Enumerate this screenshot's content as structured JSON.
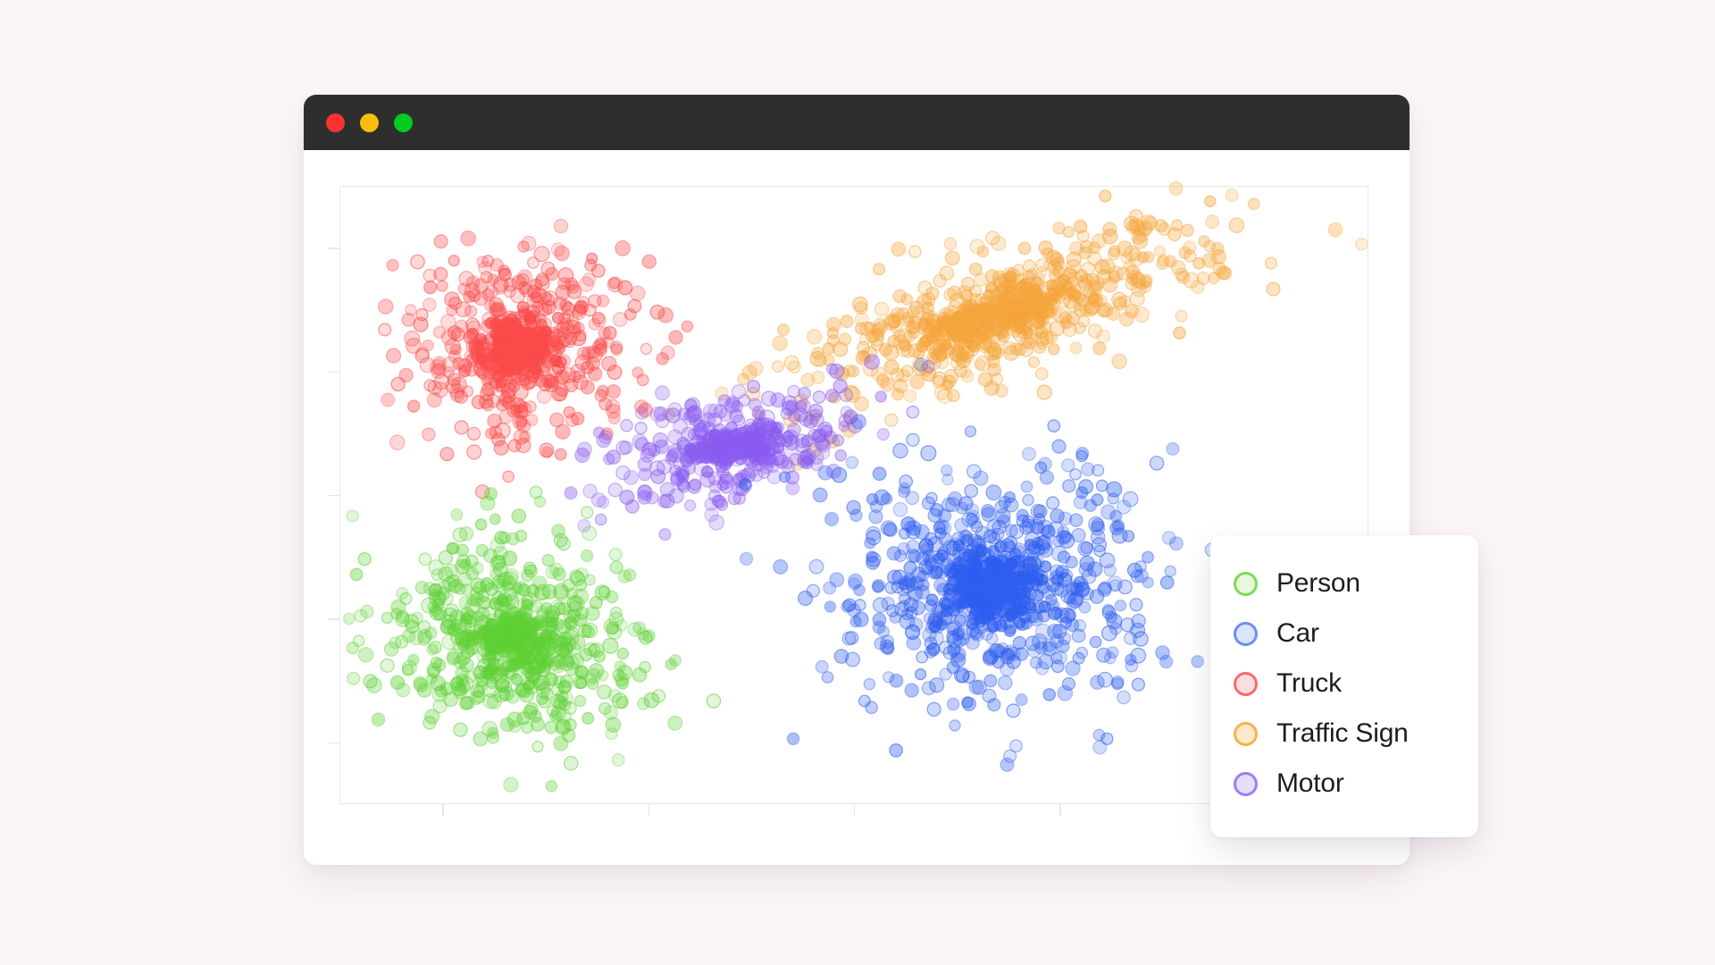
{
  "window": {
    "titlebar": {
      "background_color": "#2e2e2e",
      "buttons": [
        {
          "name": "close",
          "color": "#f8332f"
        },
        {
          "name": "minimize",
          "color": "#f9bd0a"
        },
        {
          "name": "zoom",
          "color": "#00cc1f"
        }
      ]
    }
  },
  "page": {
    "background_color": "#fbf6f9"
  },
  "legend": {
    "position": "bottom-right",
    "items": [
      {
        "label": "Person",
        "color": "#7ed957",
        "fill": "#e8f8dd"
      },
      {
        "label": "Car",
        "color": "#6c8ef5",
        "fill": "#dde5fb"
      },
      {
        "label": "Truck",
        "color": "#fb6b6b",
        "fill": "#fddede"
      },
      {
        "label": "Traffic Sign",
        "color": "#f7b24a",
        "fill": "#fdeacd"
      },
      {
        "label": "Motor",
        "color": "#9b7ef0",
        "fill": "#e7def9"
      }
    ]
  },
  "chart_data": {
    "type": "scatter",
    "title": "",
    "xlabel": "",
    "ylabel": "",
    "xlim": [
      0,
      100
    ],
    "ylim": [
      0,
      100
    ],
    "grid": false,
    "x_tick_count": 5,
    "y_tick_count": 5,
    "x_tick_labels": [],
    "y_tick_labels": [],
    "legend_position": "bottom-right",
    "marker": {
      "shape": "circle",
      "radius": 7,
      "fill_opacity": 0.32,
      "stroke_opacity": 0.55
    },
    "series": [
      {
        "name": "Truck",
        "color": "#fb4b4b",
        "point_count": 620,
        "center_x": 17.5,
        "center_y": 74.0,
        "spread_x": 5.4,
        "spread_y": 7.8,
        "core_density": 0.34,
        "seed": 11
      },
      {
        "name": "Traffic Sign",
        "color": "#f5a63c",
        "point_count": 720,
        "center_x": 63.5,
        "center_y": 79.0,
        "spread_x": 10.5,
        "spread_y": 5.0,
        "tilt": 0.52,
        "core_density": 0.22,
        "seed": 23
      },
      {
        "name": "Motor",
        "color": "#8a5df0",
        "point_count": 430,
        "center_x": 38.5,
        "center_y": 58.0,
        "spread_x": 6.2,
        "spread_y": 4.2,
        "tilt": 0.3,
        "core_density": 0.3,
        "seed": 37
      },
      {
        "name": "Person",
        "color": "#5fd135",
        "point_count": 660,
        "center_x": 17.0,
        "center_y": 27.0,
        "spread_x": 6.2,
        "spread_y": 8.0,
        "core_density": 0.18,
        "seed": 53
      },
      {
        "name": "Car",
        "color": "#2f5ef0",
        "point_count": 880,
        "center_x": 63.5,
        "center_y": 35.0,
        "spread_x": 7.8,
        "spread_y": 9.6,
        "core_density": 0.3,
        "seed": 71
      }
    ]
  }
}
